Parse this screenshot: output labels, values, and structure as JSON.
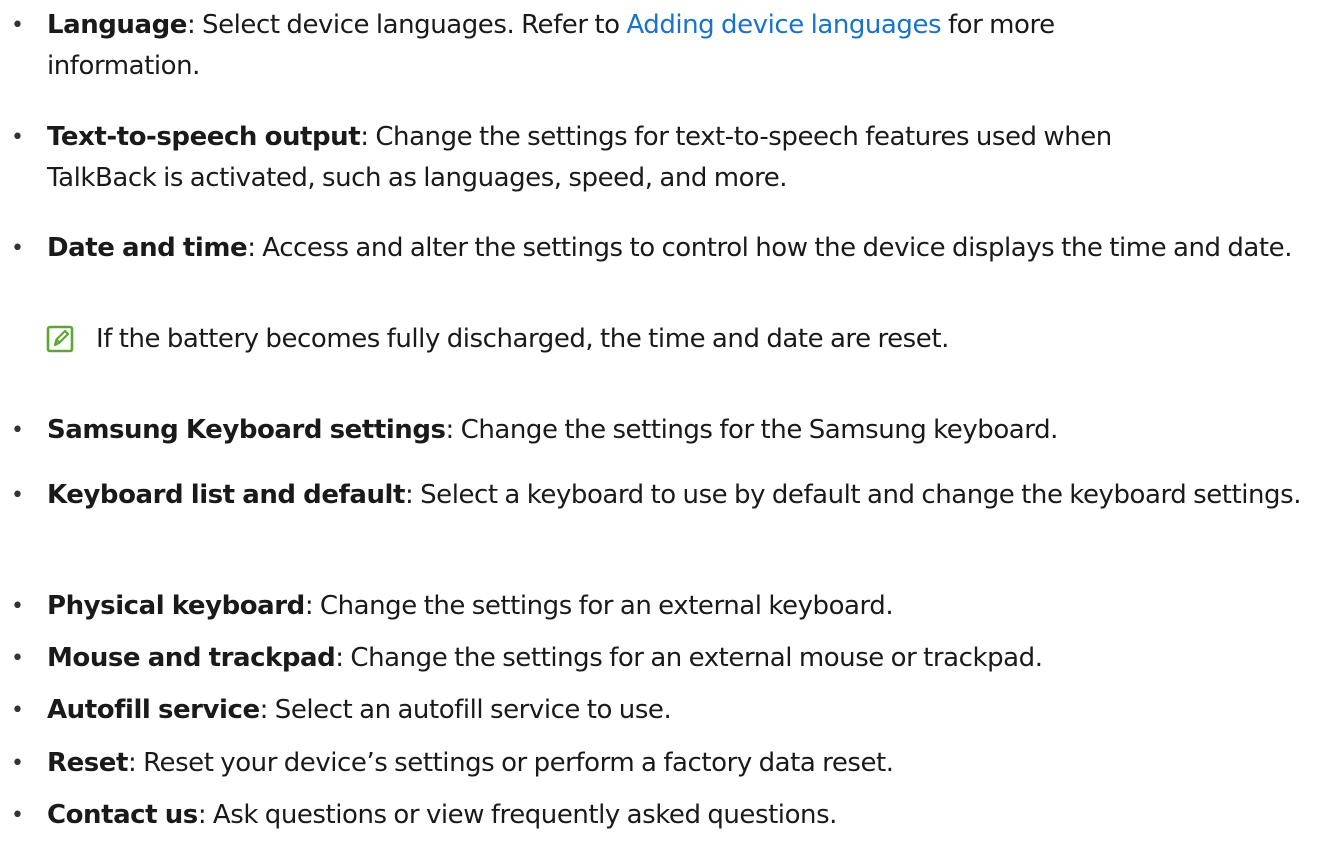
{
  "items": [
    {
      "term": "Language",
      "desc_before": ": Select device languages. Refer to ",
      "link": "Adding device languages",
      "desc_after": " for more information."
    },
    {
      "term": "Text-to-speech output",
      "desc": ": Change the settings for text-to-speech features used when TalkBack is activated, such as languages, speed, and more."
    },
    {
      "term": "Date and time",
      "desc": ": Access and alter the settings to control how the device displays the time and date."
    },
    {
      "term": "Samsung Keyboard settings",
      "desc": ": Change the settings for the Samsung keyboard."
    },
    {
      "term": "Keyboard list and default",
      "desc": ": Select a keyboard to use by default and change the keyboard settings."
    },
    {
      "term": "Physical keyboard",
      "desc": ": Change the settings for an external keyboard."
    },
    {
      "term": "Mouse and trackpad",
      "desc": ": Change the settings for an external mouse or trackpad."
    },
    {
      "term": "Autofill service",
      "desc": ": Select an autofill service to use."
    },
    {
      "term": "Reset",
      "desc": ": Reset your device’s settings or perform a factory data reset."
    },
    {
      "term": "Contact us",
      "desc": ": Ask questions or view frequently asked questions."
    }
  ],
  "note": {
    "icon": "note-pencil-icon",
    "text": "If the battery becomes fully discharged, the time and date are reset."
  },
  "bullet_char": "•",
  "colors": {
    "link": "#1a73c8",
    "note_icon": "#5aa832",
    "text": "#1a1a1a"
  }
}
